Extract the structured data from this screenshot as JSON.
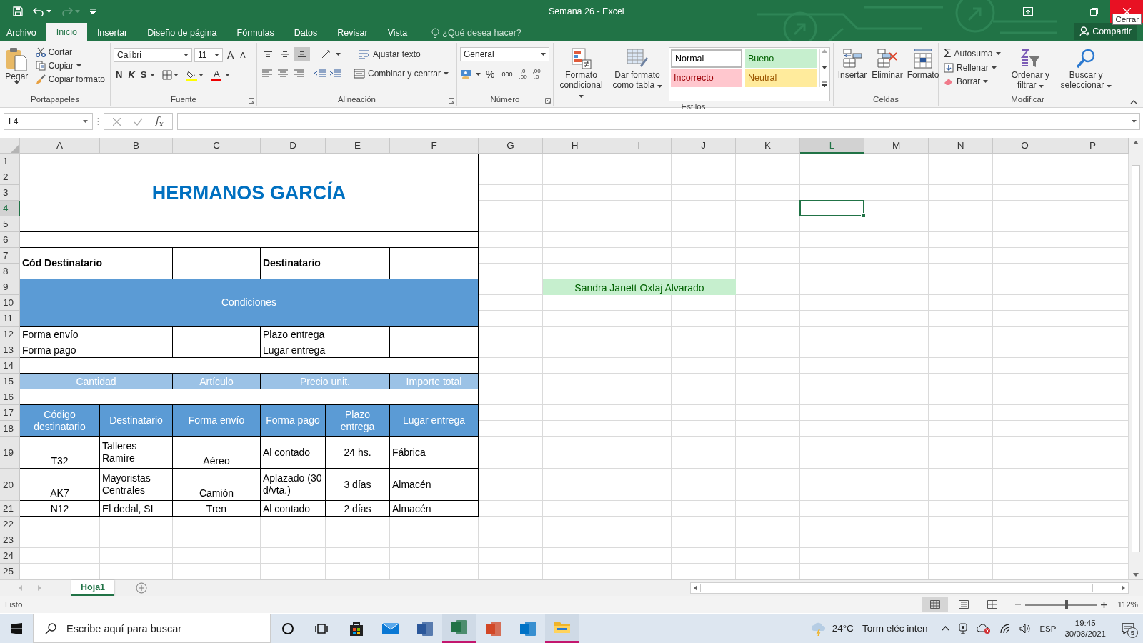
{
  "window": {
    "title": "Semana 26 - Excel",
    "tooltip": "Cerrar"
  },
  "menu_tabs": [
    {
      "label": "Archivo",
      "selected": false
    },
    {
      "label": "Inicio",
      "selected": true
    },
    {
      "label": "Insertar",
      "selected": false
    },
    {
      "label": "Diseño de página",
      "selected": false
    },
    {
      "label": "Fórmulas",
      "selected": false
    },
    {
      "label": "Datos",
      "selected": false
    },
    {
      "label": "Revisar",
      "selected": false
    },
    {
      "label": "Vista",
      "selected": false
    }
  ],
  "tell_me": {
    "placeholder": "¿Qué desea hacer?"
  },
  "share": "Compartir",
  "ribbon": {
    "groups": [
      {
        "kind": "clipboard",
        "label": "Portapapeles",
        "large": "Pegar",
        "small": [
          "Cortar",
          "Copiar",
          "Copiar formato"
        ]
      },
      {
        "kind": "font",
        "label": "Fuente",
        "font": "Calibri",
        "size": "11",
        "size_buttons": [
          {
            "label": "A",
            "kind": "grow"
          },
          {
            "label": "A",
            "kind": "shrink"
          }
        ],
        "style_buttons": [
          {
            "label": "N",
            "kind": "bold"
          },
          {
            "label": "K",
            "kind": "italic"
          },
          {
            "label": "S",
            "kind": "underline"
          }
        ],
        "font_color": "A"
      },
      {
        "kind": "alignment",
        "label": "Alineación",
        "align_buttons": [
          {
            "kind": "top",
            "selected": false
          },
          {
            "kind": "middle",
            "selected": false
          },
          {
            "kind": "bottom",
            "selected": true
          }
        ],
        "wrap": "Ajustar texto",
        "merge": "Combinar y centrar"
      },
      {
        "kind": "number",
        "label": "Número",
        "format": "General",
        "buttons": [
          "%",
          "000"
        ],
        "decimals": [
          {
            "top": ",0",
            "bottom": ",00"
          },
          {
            "top": ",00",
            "bottom": ",0"
          }
        ]
      },
      {
        "kind": "styles",
        "label": "Estilos",
        "large": [
          "Formato condicional",
          "Dar formato como tabla"
        ],
        "styles": [
          {
            "label": "Normal",
            "kind": "normal"
          },
          {
            "label": "Bueno",
            "kind": "good"
          },
          {
            "label": "Incorrecto",
            "kind": "bad"
          },
          {
            "label": "Neutral",
            "kind": "neutral"
          }
        ]
      },
      {
        "kind": "cells",
        "label": "Celdas",
        "large": [
          "Insertar",
          "Eliminar",
          "Formato"
        ]
      },
      {
        "kind": "editing",
        "label": "Modificar",
        "sum_symbol": "Σ",
        "small": [
          "Autosuma",
          "Rellenar",
          "Borrar"
        ],
        "large": [
          "Ordenar y filtrar",
          "Buscar y seleccionar"
        ]
      }
    ]
  },
  "formula_bar": {
    "name_box": "L4",
    "fx": "f$_{x}$"
  },
  "columns": [
    {
      "label": "A",
      "selected": false
    },
    {
      "label": "B",
      "selected": false
    },
    {
      "label": "C",
      "selected": false
    },
    {
      "label": "D",
      "selected": false
    },
    {
      "label": "E",
      "selected": false
    },
    {
      "label": "F",
      "selected": false
    },
    {
      "label": "G",
      "selected": false
    },
    {
      "label": "H",
      "selected": false
    },
    {
      "label": "I",
      "selected": false
    },
    {
      "label": "J",
      "selected": false
    },
    {
      "label": "K",
      "selected": false
    },
    {
      "label": "L",
      "selected": true
    },
    {
      "label": "M",
      "selected": false
    },
    {
      "label": "N",
      "selected": false
    },
    {
      "label": "O",
      "selected": false
    },
    {
      "label": "P",
      "selected": false
    }
  ],
  "rows": [
    {
      "label": "1",
      "selected": false
    },
    {
      "label": "2",
      "selected": false
    },
    {
      "label": "3",
      "selected": false
    },
    {
      "label": "4",
      "selected": true
    },
    {
      "label": "5",
      "selected": false
    },
    {
      "label": "6",
      "selected": false
    },
    {
      "label": "7",
      "selected": false
    },
    {
      "label": "8",
      "selected": false
    },
    {
      "label": "9",
      "selected": false
    },
    {
      "label": "10",
      "selected": false
    },
    {
      "label": "11",
      "selected": false
    },
    {
      "label": "12",
      "selected": false
    },
    {
      "label": "13",
      "selected": false
    },
    {
      "label": "14",
      "selected": false
    },
    {
      "label": "15",
      "selected": false
    },
    {
      "label": "16",
      "selected": false
    },
    {
      "label": "17",
      "selected": false
    },
    {
      "label": "18",
      "selected": false
    },
    {
      "label": "19",
      "selected": false
    },
    {
      "label": "20",
      "selected": false
    },
    {
      "label": "21",
      "selected": false
    },
    {
      "label": "22",
      "selected": false
    },
    {
      "label": "23",
      "selected": false
    },
    {
      "label": "24",
      "selected": false
    },
    {
      "label": "25",
      "selected": false
    }
  ],
  "cells": [
    {
      "kind": "title",
      "text": "HERMANOS GARCÍA"
    },
    {
      "kind": "label",
      "text": "Cód Destinatario"
    },
    {
      "kind": "label",
      "text": "Destinatario"
    },
    {
      "kind": "band",
      "text": "Condiciones"
    },
    {
      "kind": "text",
      "text": "Forma envío"
    },
    {
      "kind": "text",
      "text": "Plazo entrega"
    },
    {
      "kind": "text",
      "text": "Forma pago"
    },
    {
      "kind": "text",
      "text": "Lugar entrega"
    },
    {
      "kind": "subhead",
      "text": "Cantidad"
    },
    {
      "kind": "subhead",
      "text": "Artículo"
    },
    {
      "kind": "subhead",
      "text": "Precio unit."
    },
    {
      "kind": "subhead",
      "text": "Importe total"
    },
    {
      "kind": "band",
      "text": "Código destinatario"
    },
    {
      "kind": "band",
      "text": "Destinatario"
    },
    {
      "kind": "band",
      "text": "Forma envío"
    },
    {
      "kind": "band",
      "text": "Forma pago"
    },
    {
      "kind": "band",
      "text": "Plazo entrega"
    },
    {
      "kind": "band",
      "text": "Lugar entrega"
    },
    {
      "kind": "text",
      "text": "T32"
    },
    {
      "kind": "text",
      "text": "Talleres Ramíre"
    },
    {
      "kind": "text",
      "text": "Aéreo"
    },
    {
      "kind": "text",
      "text": "Al contado"
    },
    {
      "kind": "text",
      "text": "24 hs."
    },
    {
      "kind": "text",
      "text": "Fábrica"
    },
    {
      "kind": "text",
      "text": "AK7"
    },
    {
      "kind": "text",
      "text": "Mayoristas Centrales"
    },
    {
      "kind": "text",
      "text": "Camión"
    },
    {
      "kind": "text",
      "text": "Aplazado (30 d/vta.)"
    },
    {
      "kind": "text",
      "text": "3 días"
    },
    {
      "kind": "text",
      "text": "Almacén"
    },
    {
      "kind": "text",
      "text": "N12"
    },
    {
      "kind": "text",
      "text": "El dedal, SL"
    },
    {
      "kind": "text",
      "text": "Tren"
    },
    {
      "kind": "text",
      "text": "Al contado"
    },
    {
      "kind": "text",
      "text": "2 días"
    },
    {
      "kind": "text",
      "text": "Almacén"
    },
    {
      "kind": "highlight",
      "text": "Sandra Janett Oxlaj Alvarado"
    }
  ],
  "sheet_tabs": [
    {
      "label": "Hoja1",
      "selected": true
    }
  ],
  "status_bar": {
    "text": "Listo",
    "views": [
      {
        "kind": "normal",
        "selected": true
      },
      {
        "kind": "layout",
        "selected": false
      },
      {
        "kind": "breaks",
        "selected": false
      }
    ],
    "zoom_slider": {
      "level": 0.58
    },
    "zoom": "112%"
  },
  "taskbar": {
    "search": {
      "placeholder": "Escribe aquí para buscar"
    },
    "apps": [
      {
        "kind": "cortana",
        "open": false
      },
      {
        "kind": "taskview",
        "open": false
      },
      {
        "kind": "store",
        "open": false
      },
      {
        "kind": "mail",
        "open": false
      },
      {
        "kind": "word",
        "open": false
      },
      {
        "kind": "excel",
        "open": true
      },
      {
        "kind": "powerpoint",
        "open": false
      },
      {
        "kind": "outlook",
        "open": false
      },
      {
        "kind": "explorer",
        "open": true
      }
    ],
    "temperature": "24°C",
    "weather": "Torm eléc inten",
    "language": "ESP",
    "time": "19:45",
    "date": "30/08/2021",
    "notifications": "5"
  }
}
